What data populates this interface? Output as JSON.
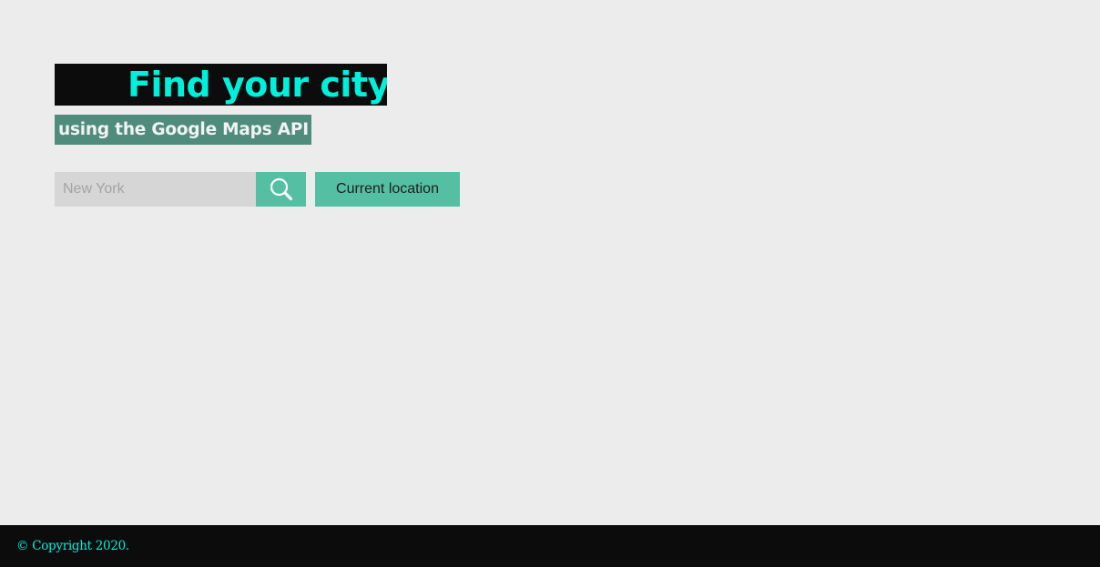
{
  "header": {
    "title": "Find your city",
    "subtitle": "using the Google Maps API"
  },
  "search": {
    "placeholder": "New York",
    "value": "",
    "button_icon": "search-icon",
    "location_label": "Current location"
  },
  "footer": {
    "copyright": "© Copyright 2020."
  },
  "colors": {
    "background": "#ececec",
    "title_bg": "#0c0c0c",
    "title_text": "#00f0dc",
    "subtitle_bg": "#4f8c7c",
    "accent": "#55bfa3",
    "input_bg": "#d6d6d6"
  }
}
